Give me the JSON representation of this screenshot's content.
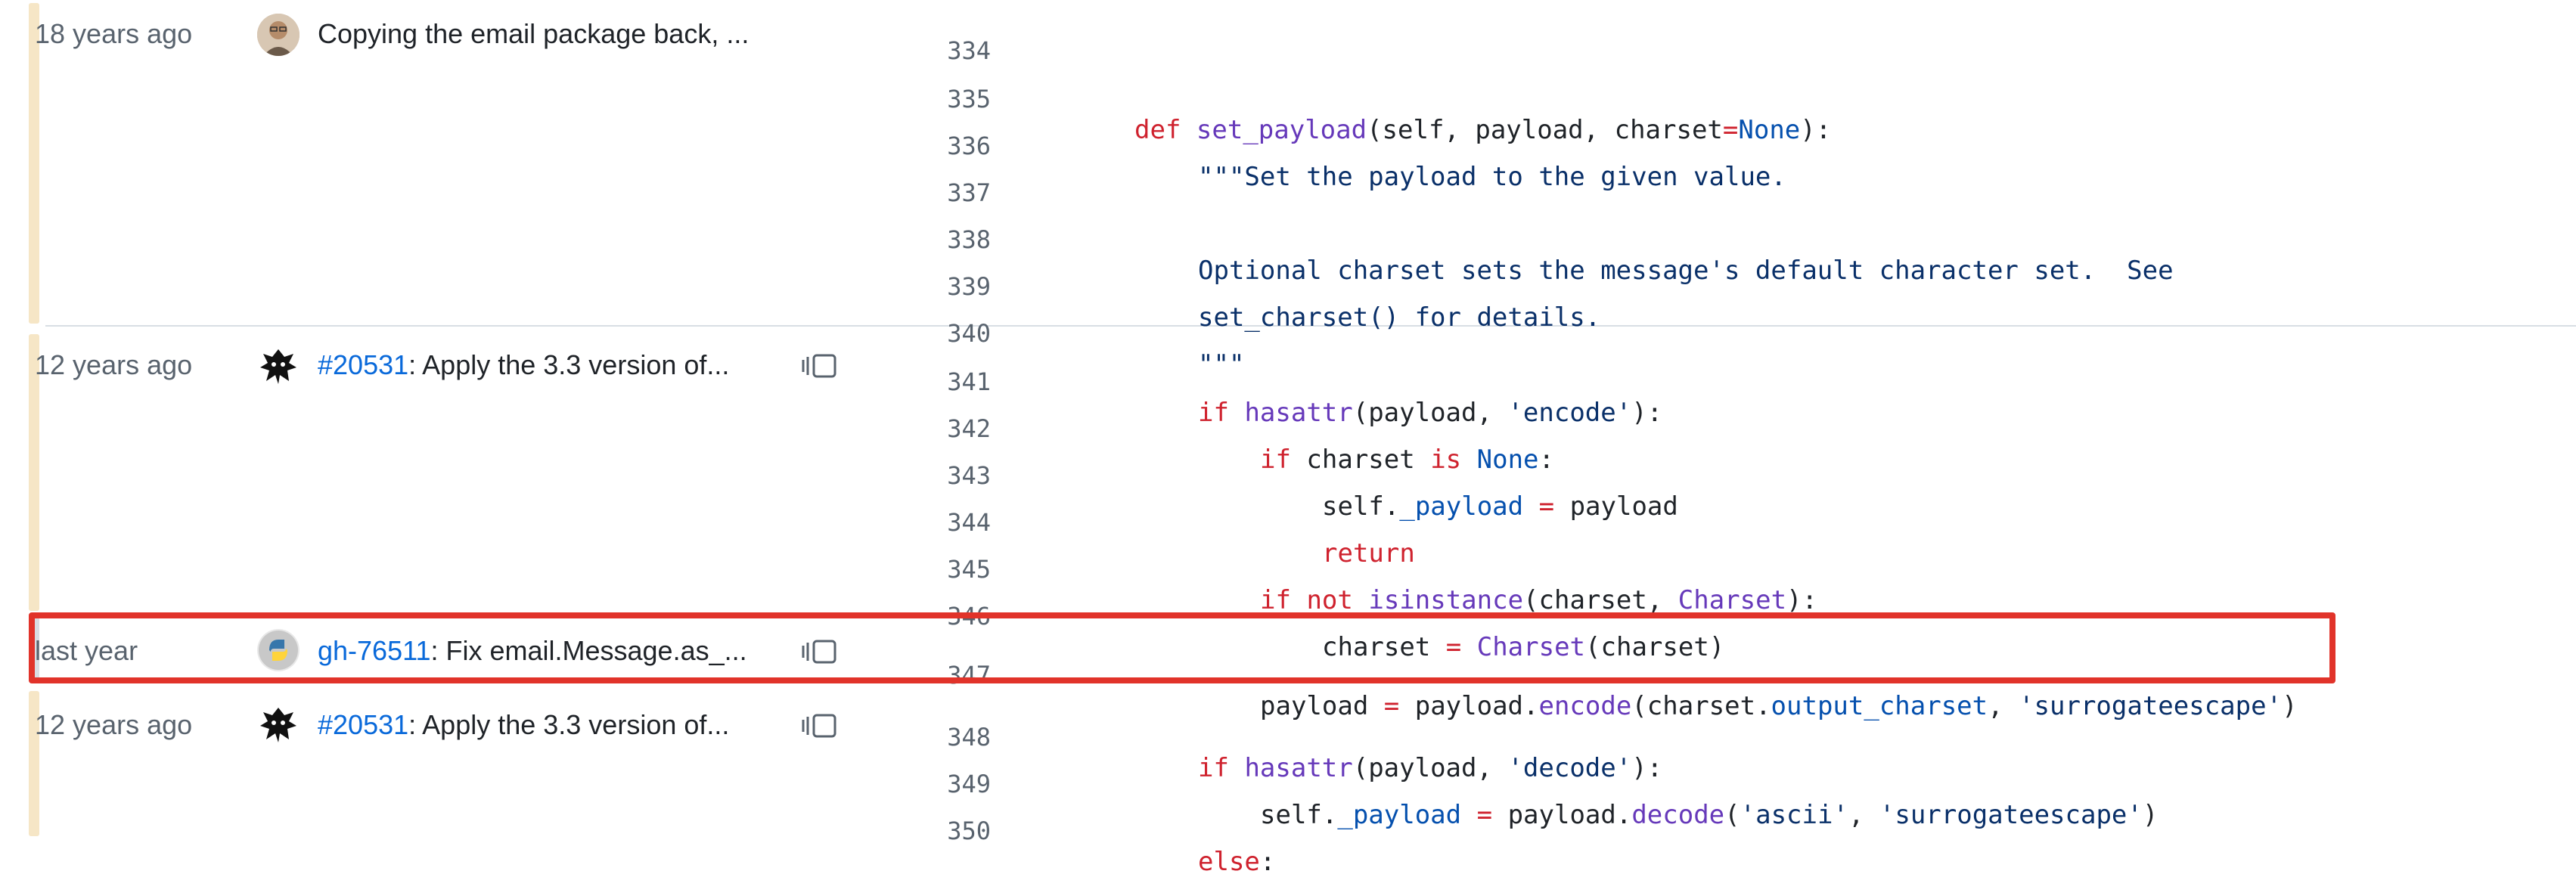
{
  "blame": [
    {
      "age": "18 years ago",
      "message": "Copying the email package back, ...",
      "link": ""
    },
    {
      "age": "12 years ago",
      "link": "#20531",
      "message": ": Apply the 3.3 version of..."
    },
    {
      "age": "last year",
      "link": "gh-76511",
      "message": ": Fix email.Message.as_..."
    },
    {
      "age": "12 years ago",
      "link": "#20531",
      "message": ": Apply the 3.3 version of..."
    }
  ],
  "lines": {
    "n334": "334",
    "n335": "335",
    "n336": "336",
    "n337": "337",
    "n338": "338",
    "n339": "339",
    "n340": "340",
    "n341": "341",
    "n342": "342",
    "n343": "343",
    "n344": "344",
    "n345": "345",
    "n346": "346",
    "n347": "347",
    "n348": "348",
    "n349": "349",
    "n350": "350"
  },
  "code": {
    "l335": {
      "a": "def",
      "b": " ",
      "c": "set_payload",
      "d": "(self, payload, charset",
      "e": "=",
      "f": "None",
      "g": "):"
    },
    "l336": "\"\"\"Set the payload to the given value.",
    "l338": "Optional charset sets the message's default character set.  See",
    "l339": "set_charset() for details.",
    "l340": "\"\"\"",
    "l341": {
      "a": "if",
      "b": " ",
      "c": "hasattr",
      "d": "(payload, ",
      "e": "'encode'",
      "f": "):"
    },
    "l342": {
      "a": "if",
      "b": " charset ",
      "c": "is",
      "d": " ",
      "e": "None",
      "f": ":"
    },
    "l343": {
      "a": "self.",
      "b": "_payload",
      "c": " ",
      "d": "=",
      "e": " payload"
    },
    "l344": "return",
    "l345": {
      "a": "if",
      "b": " ",
      "c": "not",
      "d": " ",
      "e": "isinstance",
      "f": "(charset, ",
      "g": "Charset",
      "h": "):"
    },
    "l346": {
      "a": "charset ",
      "b": "=",
      "c": " ",
      "d": "Charset",
      "e": "(charset)"
    },
    "l347": {
      "a": "payload ",
      "b": "=",
      "c": " payload.",
      "d": "encode",
      "e": "(charset.",
      "f": "output_charset",
      "g": ", ",
      "h": "'surrogateescape'",
      "i": ")"
    },
    "l348": {
      "a": "if",
      "b": " ",
      "c": "hasattr",
      "d": "(payload, ",
      "e": "'decode'",
      "f": "):"
    },
    "l349": {
      "a": "self.",
      "b": "_payload",
      "c": " ",
      "d": "=",
      "e": " payload.",
      "f": "decode",
      "g": "(",
      "h": "'ascii'",
      "i": ", ",
      "j": "'surrogateescape'",
      "k": ")"
    },
    "l350": {
      "a": "else",
      "b": ":"
    }
  },
  "colors": {
    "old_age_bar": "#f6e6c6",
    "recent_age_bar": "#d9dde3",
    "highlight": "#e1332a"
  }
}
